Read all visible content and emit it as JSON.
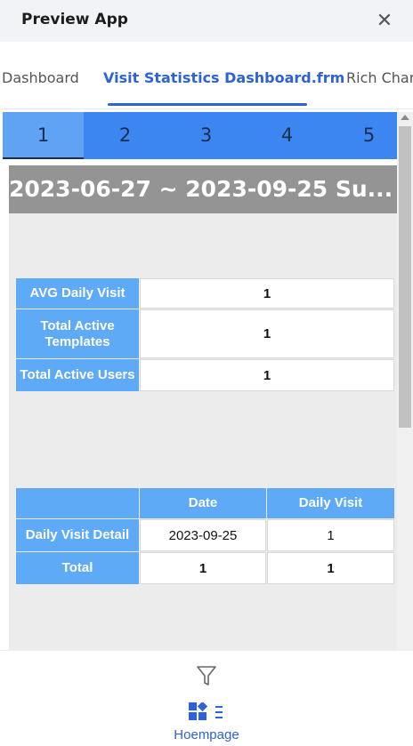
{
  "app": {
    "title": "Preview App",
    "close_icon": "close-icon"
  },
  "tabs": [
    {
      "label": "Dashboard",
      "active": false
    },
    {
      "label": "Visit Statistics Dashboard.frm",
      "active": true
    },
    {
      "label": "Rich Char",
      "active": false
    }
  ],
  "pager": {
    "pages": [
      "1",
      "2",
      "3",
      "4",
      "5"
    ],
    "selected": "1"
  },
  "report": {
    "banner": "2023-06-27 ~ 2023-09-25 Su...",
    "summary": [
      {
        "label": "AVG Daily Visit",
        "value": "1"
      },
      {
        "label": "Total Active Templates",
        "value": "1"
      },
      {
        "label": "Total Active Users",
        "value": "1"
      }
    ],
    "detail": {
      "header_date": "Date",
      "header_daily_visit": "Daily Visit",
      "row_label": "Daily Visit Detail",
      "row_date": "2023-09-25",
      "row_visit": "1",
      "total_label": "Total",
      "total_date": "1",
      "total_visit": "1"
    }
  },
  "bottom_nav": {
    "filter_icon": "filter-icon",
    "home_icon": "dashboard-icon",
    "home_label": "Hoempage"
  },
  "colors": {
    "accent": "#2d63d6",
    "pager_bg": "#3b86f0",
    "label_bg": "#5eaaf7",
    "banner_bg": "#949494",
    "report_bg": "#ececec"
  }
}
